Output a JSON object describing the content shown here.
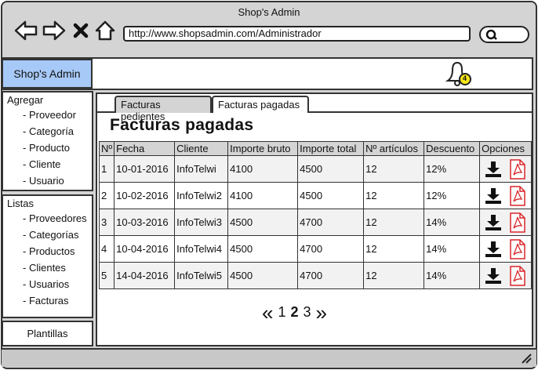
{
  "window": {
    "title": "Shop's Admin"
  },
  "browser": {
    "url": "http://www.shopsadmin.com/Administrador"
  },
  "header": {
    "brand": "Shop's Admin",
    "notification_count": "4"
  },
  "sidebar": {
    "agregar": {
      "title": "Agregar",
      "items": [
        "- Proveedor",
        "- Categoría",
        "- Producto",
        "- Cliente",
        "- Usuario"
      ]
    },
    "listas": {
      "title": "Listas",
      "items": [
        "- Proveedores",
        "- Categorías",
        "- Productos",
        "- Clientes",
        "- Usuarios",
        "- Facturas"
      ]
    },
    "plantillas": "Plantillas"
  },
  "tabs": [
    "Facturas pedientes",
    "Facturas pagadas"
  ],
  "page_title": "Facturas pagadas",
  "table": {
    "headers": [
      "Nº",
      "Fecha",
      "Cliente",
      "Importe bruto",
      "Importe total",
      "Nº artículos",
      "Descuento",
      "Opciones"
    ],
    "rows": [
      [
        "1",
        "10-01-2016",
        "InfoTelwi",
        "4100",
        "4500",
        "12",
        "12%"
      ],
      [
        "2",
        "10-02-2016",
        "InfoTelwi2",
        "4100",
        "4500",
        "12",
        "12%"
      ],
      [
        "3",
        "10-03-2016",
        "InfoTelwi3",
        "4500",
        "4700",
        "12",
        "14%"
      ],
      [
        "4",
        "10-04-2016",
        "InfoTelwi4",
        "4500",
        "4700",
        "12",
        "14%"
      ],
      [
        "5",
        "14-04-2016",
        "InfoTelwi5",
        "4500",
        "4700",
        "12",
        "14%"
      ]
    ]
  },
  "pagination": {
    "prev": "«",
    "pages": [
      "1",
      "2",
      "3"
    ],
    "current": "2",
    "next": "»"
  },
  "colors": {
    "brand_bg": "#a7c9f7",
    "chrome": "#d4d4d4",
    "pdf_red": "#d9262a",
    "badge": "#f5e61a"
  },
  "icons": [
    "back-icon",
    "forward-icon",
    "close-icon",
    "home-icon",
    "search-icon",
    "bell-icon",
    "user-icon",
    "chevron-down-icon",
    "download-icon",
    "pdf-icon",
    "resize-grip-icon"
  ]
}
